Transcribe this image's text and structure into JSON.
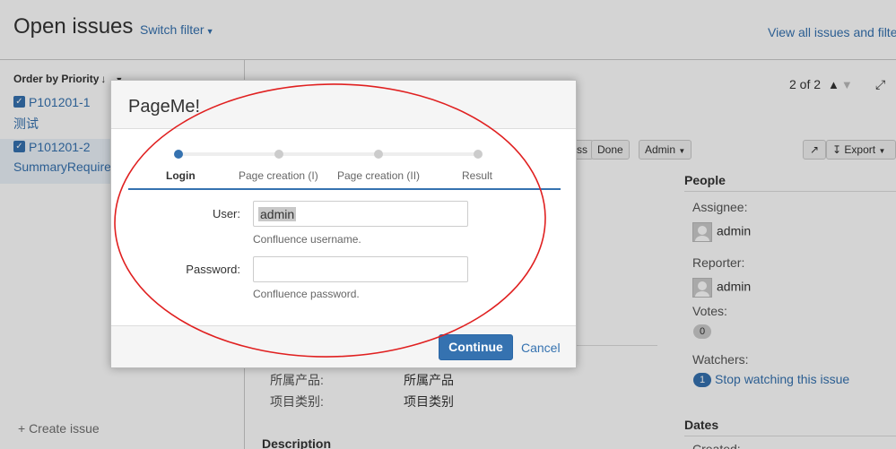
{
  "header": {
    "title": "Open issues",
    "switch_filter": "Switch filter",
    "view_all": "View all issues and filter"
  },
  "sidebar": {
    "order_by": "Order by Priority",
    "issues": [
      {
        "key": "P101201-1",
        "summary": "测试"
      },
      {
        "key": "P101201-2",
        "summary": "SummaryRequired"
      }
    ],
    "create_issue": "+ Create issue"
  },
  "pager": {
    "text": "2 of 2"
  },
  "toolbar": {
    "ss_label": "ss",
    "done_label": "Done",
    "admin_label": "Admin",
    "export_label": "Export"
  },
  "people": {
    "title": "People",
    "assignee_label": "Assignee:",
    "assignee": "admin",
    "reporter_label": "Reporter:",
    "reporter": "admin",
    "votes_label": "Votes:",
    "votes": "0",
    "watchers_label": "Watchers:",
    "watchers_count": "1",
    "watch_action": "Stop watching this issue"
  },
  "dates": {
    "title": "Dates",
    "created_label": "Created:"
  },
  "details": {
    "fields": [
      {
        "label": "所属产品:",
        "value": "所属产品"
      },
      {
        "label": "项目类别:",
        "value": "项目类别"
      }
    ],
    "description_title": "Description"
  },
  "dialog": {
    "title": "PageMe!",
    "steps": [
      "Login",
      "Page creation (I)",
      "Page creation (II)",
      "Result"
    ],
    "user_label": "User:",
    "user_value": "admin",
    "user_desc": "Confluence username.",
    "password_label": "Password:",
    "password_value": "",
    "password_desc": "Confluence password.",
    "continue_label": "Continue",
    "cancel_label": "Cancel"
  },
  "colors": {
    "accent": "#3572b0",
    "annotation": "#e02020",
    "dialog_footer": "#f5f5f5"
  }
}
